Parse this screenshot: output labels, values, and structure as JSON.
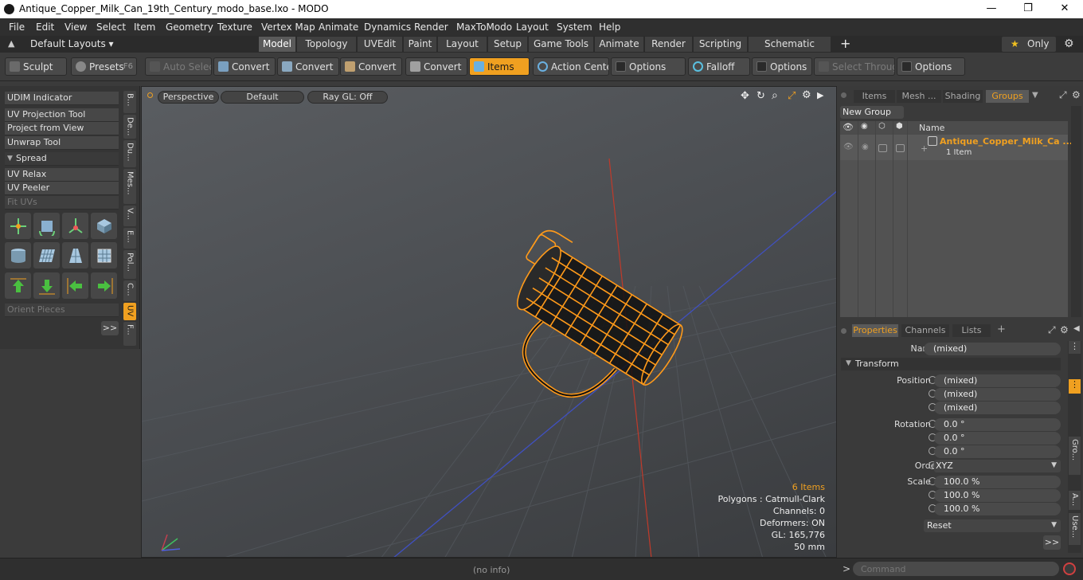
{
  "window": {
    "title": "Antique_Copper_Milk_Can_19th_Century_modo_base.lxo - MODO",
    "minimize": "—",
    "maximize": "❐",
    "close": "✕"
  },
  "menu": [
    "File",
    "Edit",
    "View",
    "Select",
    "Item",
    "Geometry",
    "Texture",
    "Vertex Map",
    "Animate",
    "Dynamics",
    "Render",
    "MaxToModo",
    "Layout",
    "System",
    "Help"
  ],
  "layoutbar": {
    "default_layouts": "Default Layouts ▾",
    "tabs": [
      "Model",
      "Topology",
      "UVEdit",
      "Paint",
      "Layout",
      "Setup",
      "Game Tools",
      "Animate",
      "Render",
      "Scripting",
      "Schematic Fusion"
    ],
    "active_tab": "Model",
    "plus": "+",
    "only": "Only"
  },
  "toolbar": {
    "sculpt": "Sculpt",
    "presets": "Presets",
    "presets_key": "F6",
    "auto_select": "Auto Select",
    "convert": "Convert",
    "items": "Items",
    "action_center": "Action Center",
    "options": "Options",
    "falloff": "Falloff",
    "select_through": "Select Through"
  },
  "left": {
    "udim": "UDIM Indicator",
    "tools": [
      "UV Projection Tool",
      "Project from View",
      "Unwrap Tool"
    ],
    "spread": "Spread",
    "relax": [
      "UV Relax",
      "UV Peeler",
      "Fit UVs"
    ],
    "orient": "Orient Pieces",
    "more": ">>",
    "vtabs": [
      "B...",
      "De...",
      "Du...",
      "Mes...",
      "V...",
      "E...",
      "Pol...",
      "C...",
      "UV",
      "F..."
    ]
  },
  "viewport": {
    "perspective": "Perspective",
    "default": "Default",
    "raygl": "Ray GL: Off",
    "stats": {
      "items": "6 Items",
      "polygons": "Polygons : Catmull-Clark",
      "channels": "Channels: 0",
      "deformers": "Deformers: ON",
      "gl": "GL: 165,776",
      "size": "50 mm"
    }
  },
  "groups": {
    "tabs": [
      "Items",
      "Mesh ...",
      "Shading",
      "Groups"
    ],
    "new_group": "New Group",
    "name_header": "Name",
    "item_name": "Antique_Copper_Milk_Ca ...",
    "item_count": "1 Item"
  },
  "properties": {
    "tabs": [
      "Properties",
      "Channels",
      "Lists"
    ],
    "name_label": "Name",
    "name_value": "(mixed)",
    "transform": "Transform",
    "position_label": "Position X",
    "rotation_label": "Rotation X",
    "scale_label": "Scale X",
    "order_label": "Order",
    "y": "Y",
    "z": "Z",
    "position": [
      "(mixed)",
      "(mixed)",
      "(mixed)"
    ],
    "rotation": [
      "0.0 °",
      "0.0 °",
      "0.0 °"
    ],
    "order": "XYZ",
    "scale": [
      "100.0 %",
      "100.0 %",
      "100.0 %"
    ],
    "reset": "Reset",
    "more": ">>",
    "side_tabs": [
      "Gro...",
      "A...",
      "Use..."
    ]
  },
  "status": {
    "info": "(no info)",
    "command_placeholder": "Command",
    "prompt": ">"
  },
  "colors": {
    "accent": "#f0a020",
    "selection": "#ff9a1a"
  }
}
